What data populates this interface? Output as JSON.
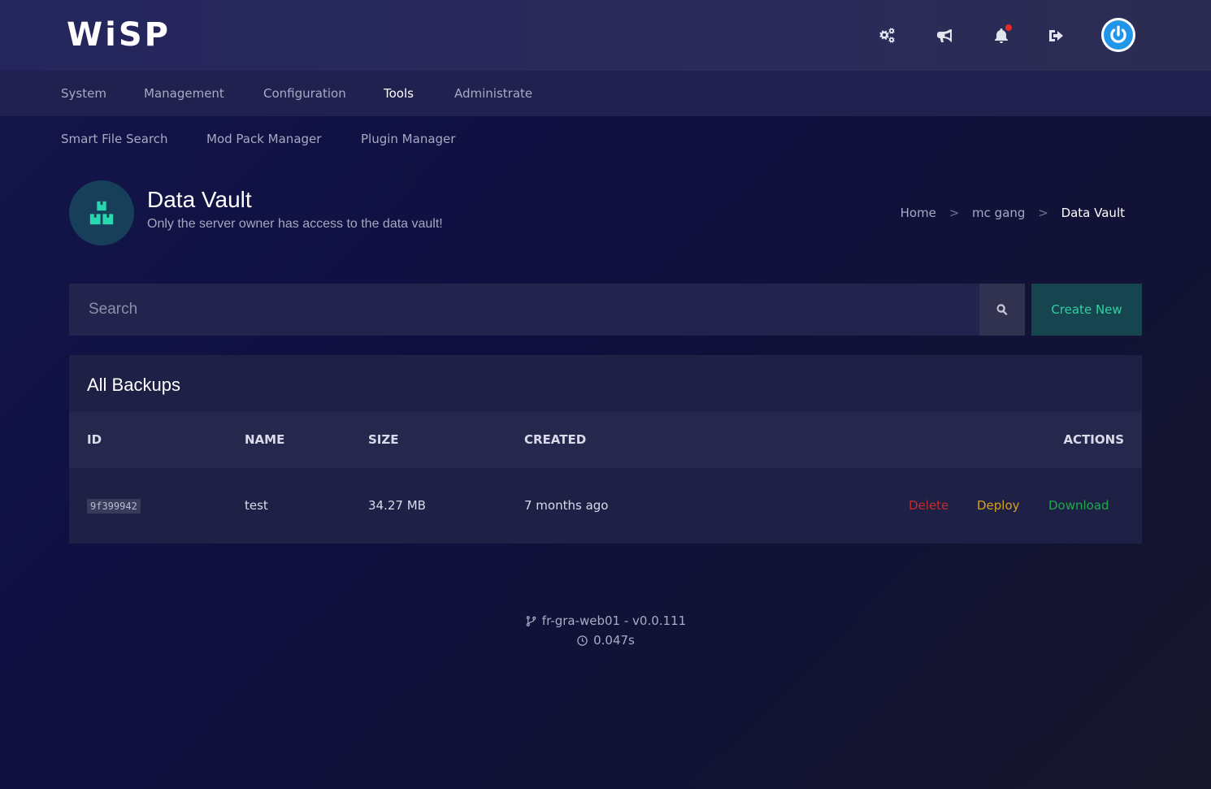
{
  "brand": {
    "logo_text": "WiSP"
  },
  "topbar": {
    "icons": [
      "settings-cogs-icon",
      "megaphone-icon",
      "bell-icon",
      "sign-out-icon",
      "power-icon"
    ],
    "accent_color": "#2196e8",
    "notification_dot_color": "#e52b2b"
  },
  "main_nav": {
    "items": [
      {
        "label": "System"
      },
      {
        "label": "Management"
      },
      {
        "label": "Configuration"
      },
      {
        "label": "Tools",
        "active": true
      },
      {
        "label": "Administrate"
      }
    ]
  },
  "sub_nav": {
    "items": [
      {
        "label": "Smart File Search"
      },
      {
        "label": "Mod Pack Manager"
      },
      {
        "label": "Plugin Manager"
      }
    ]
  },
  "page": {
    "title": "Data Vault",
    "subtitle": "Only the server owner has access to the data vault!",
    "icon": "cubes-icon",
    "icon_color": "#2ad8b0"
  },
  "breadcrumb": {
    "items": [
      "Home",
      "mc gang",
      "Data Vault"
    ],
    "separator": ">"
  },
  "search": {
    "placeholder": "Search",
    "value": ""
  },
  "create_button": {
    "label": "Create New",
    "color": "#30d0a0"
  },
  "backups": {
    "title": "All Backups",
    "columns": [
      "ID",
      "NAME",
      "SIZE",
      "CREATED",
      "ACTIONS"
    ],
    "rows": [
      {
        "id": "9f399942",
        "name": "test",
        "size": "34.27 MB",
        "created": "7 months ago",
        "actions": [
          {
            "label": "Delete",
            "color": "#c42b2b"
          },
          {
            "label": "Deploy",
            "color": "#d6a21e"
          },
          {
            "label": "Download",
            "color": "#1fa84a"
          }
        ]
      }
    ]
  },
  "footer": {
    "node": "fr-gra-web01 - v0.0.111",
    "time": "0.047s"
  }
}
